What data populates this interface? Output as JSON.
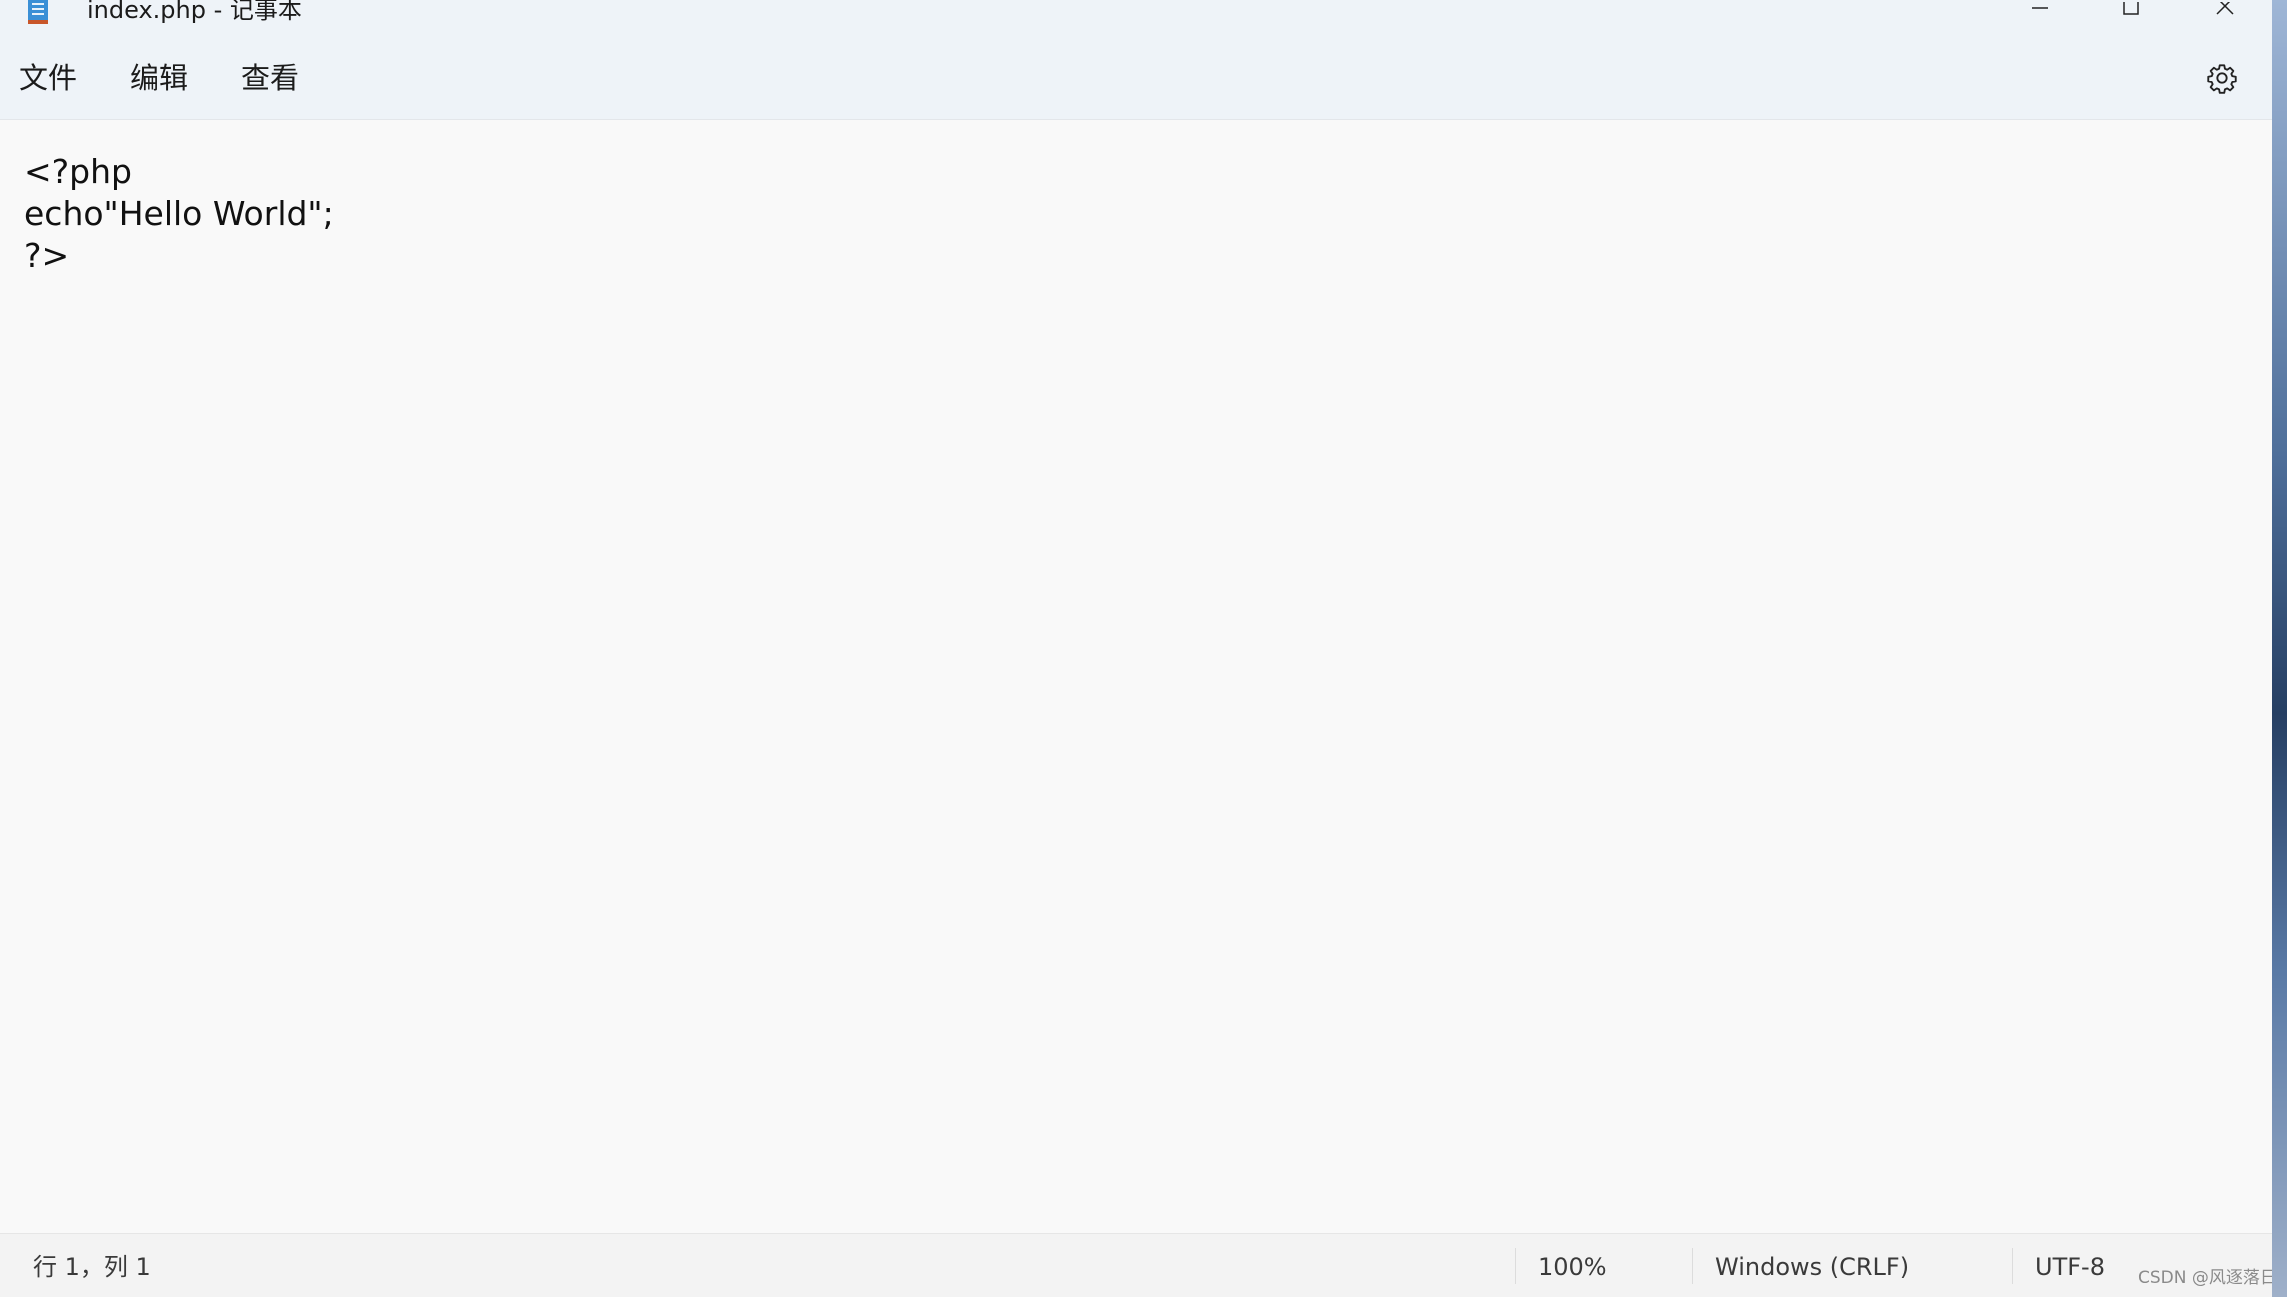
{
  "window": {
    "title": "index.php - 记事本",
    "app_icon": "notepad-icon",
    "controls": [
      "minimize-icon",
      "maximize-icon",
      "close-icon"
    ]
  },
  "menu": {
    "file": "文件",
    "edit": "编辑",
    "view": "查看",
    "settings_icon": "gear-icon"
  },
  "editor": {
    "lines": [
      "<?php",
      "echo\"Hello World\";",
      "?>"
    ]
  },
  "statusbar": {
    "position": "行 1，列 1",
    "zoom": "100%",
    "line_ending": "Windows (CRLF)",
    "encoding": "UTF-8"
  },
  "watermark": "CSDN @风逐落日"
}
